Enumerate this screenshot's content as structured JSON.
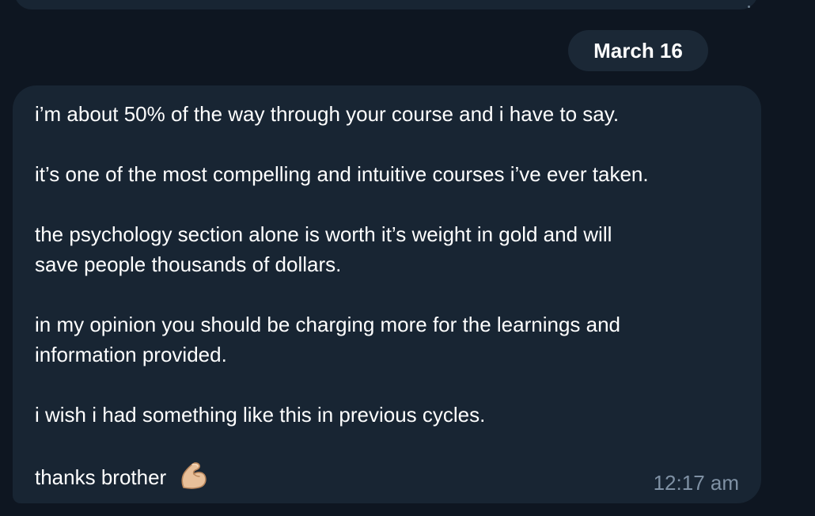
{
  "chat": {
    "date_separator": "March 16",
    "message": {
      "lines": [
        "i’m about 50% of the way through your course and i have to say.",
        "it’s one of the most compelling and intuitive courses i’ve ever taken.",
        "the psychology section alone is worth it’s weight in gold and will",
        "save people thousands of dollars.",
        "in my opinion you should be charging more for the learnings and",
        "information provided.",
        "i wish i had something like this in previous cycles.",
        "thanks brother"
      ],
      "emoji": "flexed-biceps-icon",
      "time": "12:17 am"
    }
  },
  "colors": {
    "background": "#0e1621",
    "bubble": "#182533",
    "date_pill": "#1b2836",
    "text": "#ffffff",
    "timestamp": "#7f91a4"
  }
}
